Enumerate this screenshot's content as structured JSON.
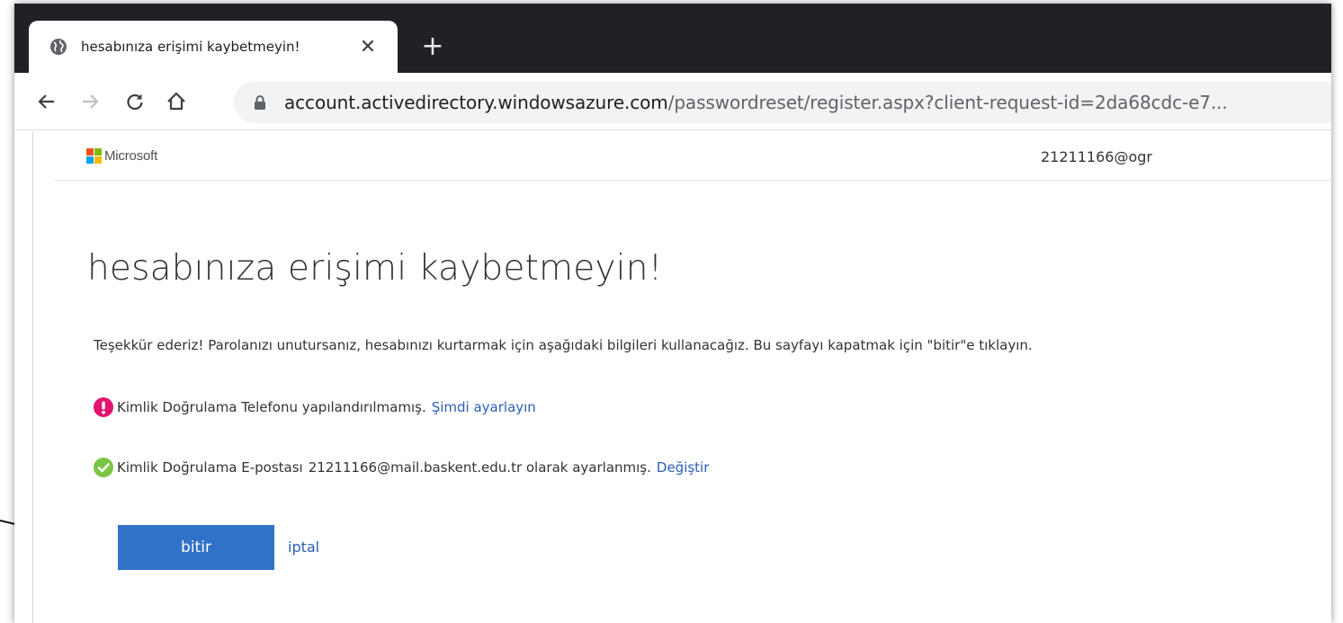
{
  "browser": {
    "tab_title": "hesabınıza erişimi kaybetmeyin!",
    "tab_close": "✕",
    "new_tab": "+",
    "url_host": "account.activedirectory.windowsazure.com",
    "url_path": "/passwordreset/register.aspx?client-request-id=2da68cdc-e7...",
    "icons": {
      "back": "back-arrow-icon",
      "forward": "forward-arrow-icon",
      "reload": "reload-icon",
      "home": "home-icon",
      "lock": "lock-icon",
      "star": "star-icon",
      "favicon": "globe-icon"
    }
  },
  "header": {
    "brand": "Microsoft",
    "user_email": "21211166@ogr"
  },
  "main": {
    "title": "hesabınıza erişimi kaybetmeyin!",
    "intro": "Teşekkür ederiz! Parolanızı unutursanız, hesabınızı kurtarmak için aşağıdaki bilgileri kullanacağız. Bu sayfayı kapatmak için \"bitir\"e tıklayın.",
    "phone_status": "Kimlik Doğrulama Telefonu yapılandırılmamış.",
    "phone_link": "Şimdi ayarlayın",
    "email_status_label": "Kimlik Doğrulama E-postası",
    "email_value": "21211166@mail.baskent.edu.tr olarak ayarlanmış.",
    "email_link": "Değiştir",
    "finish_button": "bitir",
    "cancel_link": "iptal"
  },
  "colors": {
    "accent_button": "#2f73c9",
    "link": "#2b5fb4",
    "error": "#e3156f",
    "success": "#7cc543"
  }
}
